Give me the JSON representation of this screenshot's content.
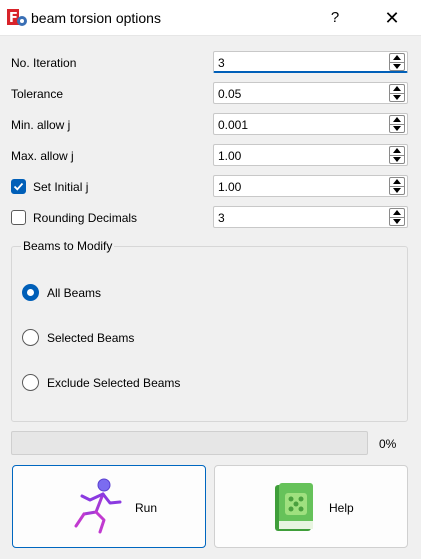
{
  "window": {
    "title": "beam torsion options",
    "help_glyph": "?",
    "close_glyph": "✕"
  },
  "fields": [
    {
      "label": "No. Iteration",
      "value": "3"
    },
    {
      "label": "Tolerance",
      "value": "0.05"
    },
    {
      "label": "Min. allow j",
      "value": "0.001"
    },
    {
      "label": "Max. allow j",
      "value": "1.00"
    },
    {
      "label": "Set Initial j",
      "value": "1.00",
      "checked": true
    },
    {
      "label": "Rounding Decimals",
      "value": "3",
      "checked": false
    }
  ],
  "group": {
    "title": "Beams to Modify",
    "options": [
      {
        "label": "All Beams",
        "selected": true
      },
      {
        "label": "Selected Beams",
        "selected": false
      },
      {
        "label": "Exclude Selected Beams",
        "selected": false
      }
    ]
  },
  "progress": {
    "value": 0,
    "text": "0%"
  },
  "buttons": {
    "run_label": "Run",
    "help_label": "Help"
  },
  "colors": {
    "accent": "#005fb8",
    "run_icon": "#7b2fd6",
    "help_icon": "#4caf50"
  },
  "icons": {
    "app": "app-gear-icon",
    "run": "running-person-icon",
    "help": "green-book-icon"
  }
}
